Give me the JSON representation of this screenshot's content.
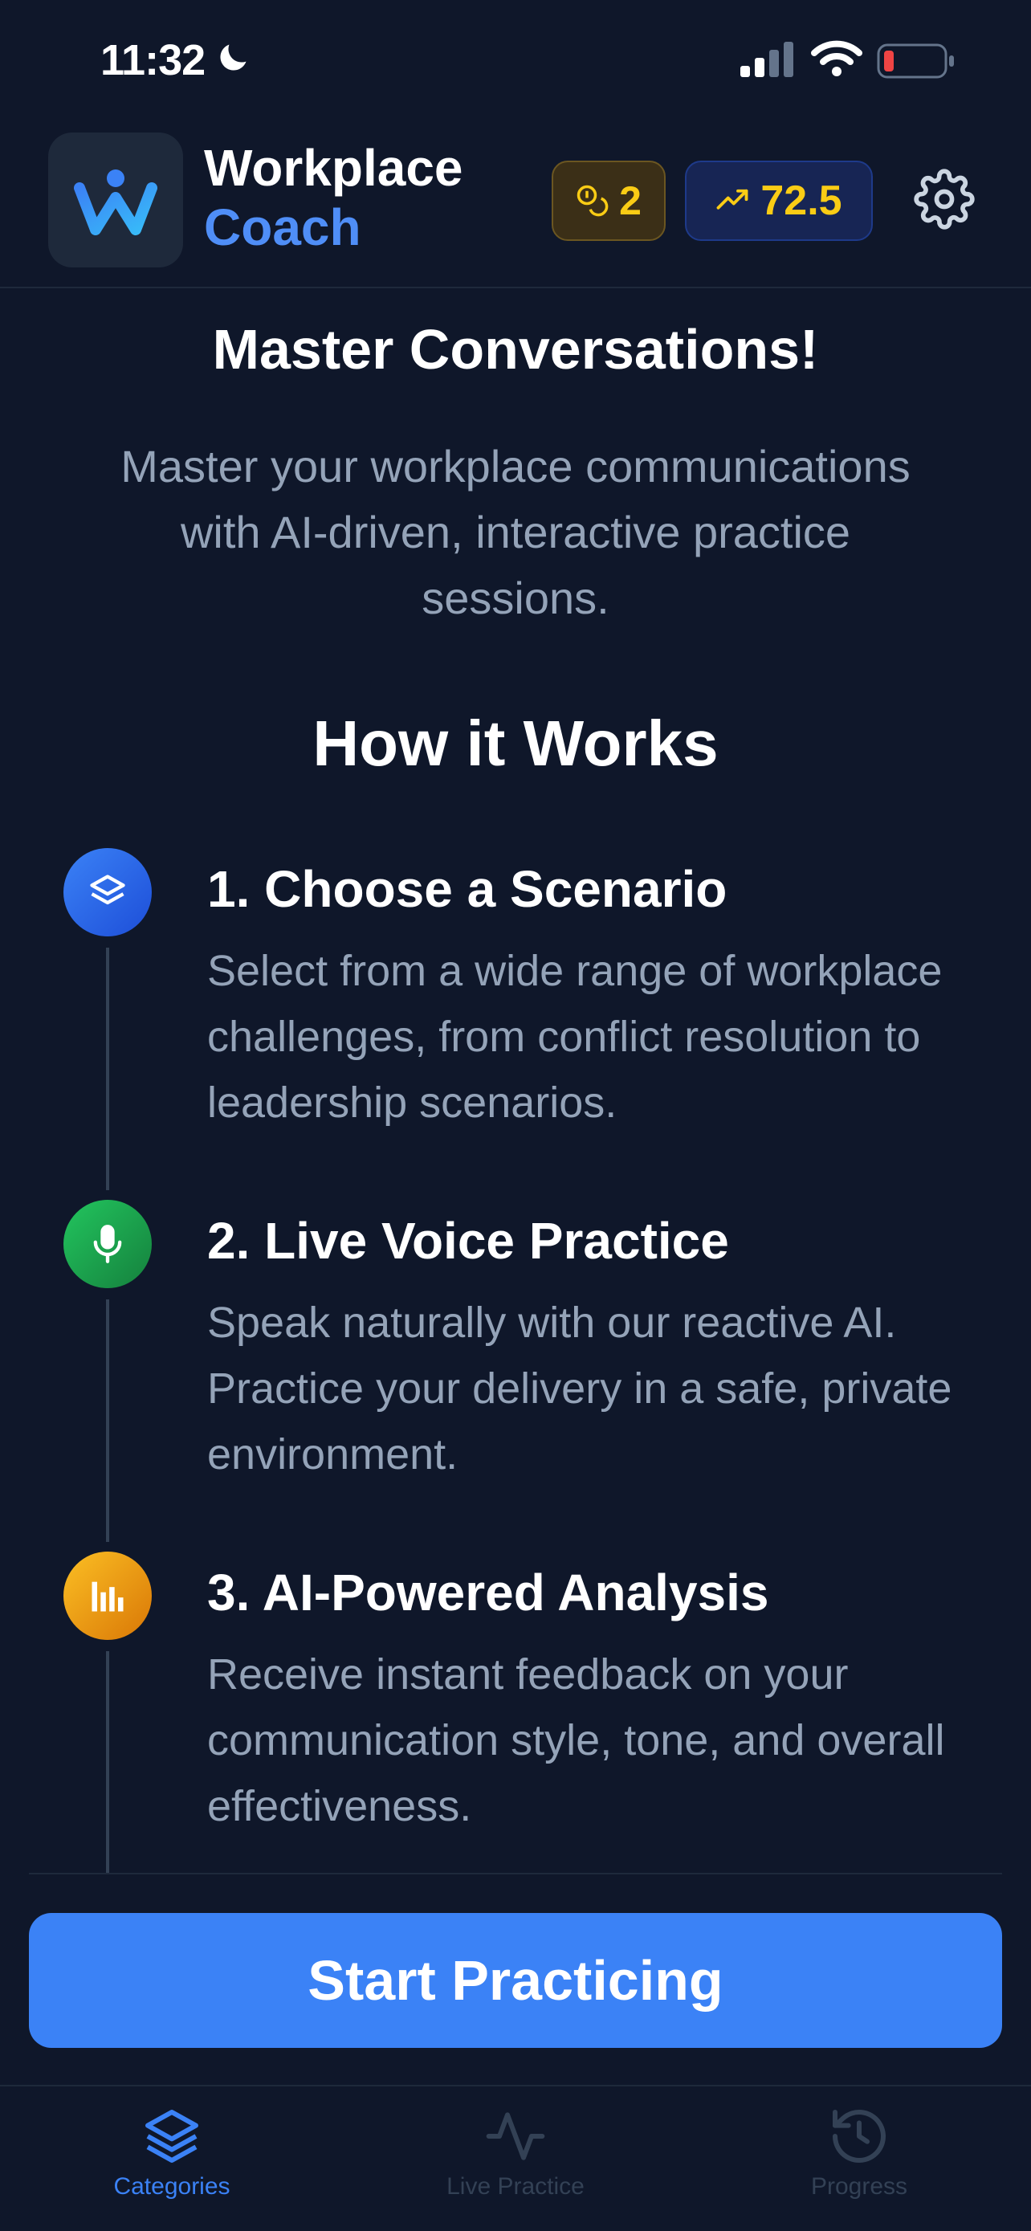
{
  "status_bar": {
    "time": "11:32"
  },
  "header": {
    "brand_line1": "Workplace",
    "brand_line2": "Coach",
    "coins": "2",
    "score": "72.5"
  },
  "hero": {
    "title": "Master Conversations!",
    "subtitle": "Master your workplace communications with AI-driven, interactive practice sessions."
  },
  "how_it_works": {
    "heading": "How it Works",
    "steps": [
      {
        "title": "1. Choose a Scenario",
        "desc": "Select from a wide range of workplace challenges, from conflict resolution to leadership scenarios.",
        "icon": "layers-icon",
        "color": "#2563eb"
      },
      {
        "title": "2. Live Voice Practice",
        "desc": "Speak naturally with our reactive AI. Practice your delivery in a safe, private environment.",
        "icon": "microphone-icon",
        "color": "#16a34a"
      },
      {
        "title": "3. AI-Powered Analysis",
        "desc": "Receive instant feedback on your communication style, tone, and overall effectiveness.",
        "icon": "bar-chart-icon",
        "color": "#f59e0b"
      }
    ]
  },
  "cta": {
    "label": "Start Practicing"
  },
  "tabs": [
    {
      "label": "Categories",
      "icon": "layers-icon",
      "active": true
    },
    {
      "label": "Live Practice",
      "icon": "activity-icon",
      "active": false
    },
    {
      "label": "Progress",
      "icon": "history-icon",
      "active": false
    }
  ],
  "colors": {
    "accent": "#3b82f6",
    "background": "#0f172a",
    "gold": "#facc15"
  }
}
